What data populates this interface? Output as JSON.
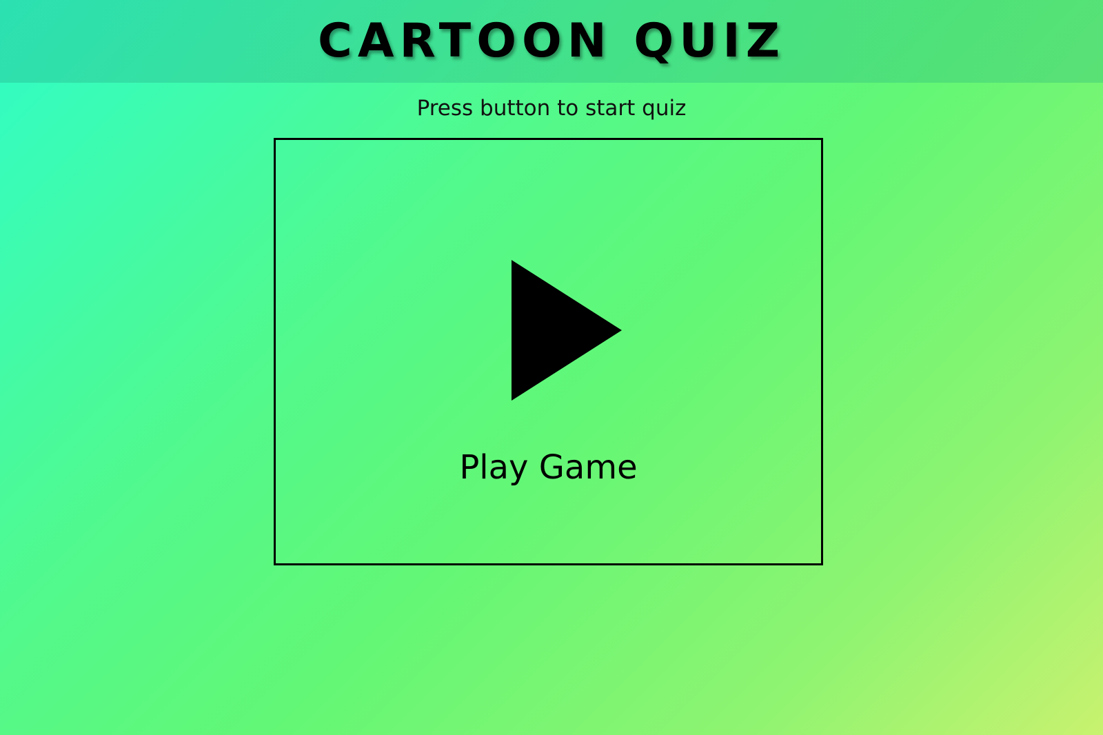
{
  "header": {
    "title": "CARTOON QUIZ"
  },
  "instruction": "Press button to start quiz",
  "play_button": {
    "label": "Play Game",
    "icon": "play-icon"
  }
}
